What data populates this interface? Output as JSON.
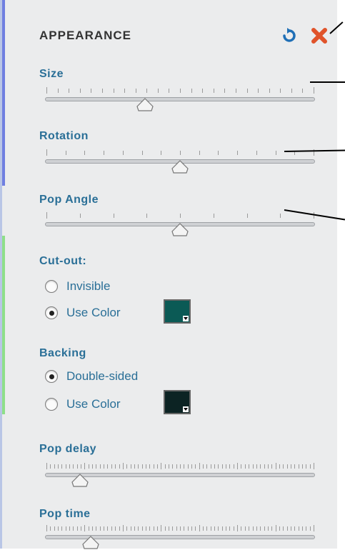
{
  "panel": {
    "title": "APPEARANCE",
    "reset_icon": "reset-icon",
    "close_icon": "close-icon",
    "accent_color": "#2a6f97"
  },
  "sliders": {
    "size": {
      "label": "Size",
      "value": 0.37
    },
    "rotation": {
      "label": "Rotation",
      "value": 0.5
    },
    "pop_angle": {
      "label": "Pop Angle",
      "value": 0.5
    },
    "pop_delay": {
      "label": "Pop delay",
      "value": 0.13
    },
    "pop_time": {
      "label": "Pop time",
      "value": 0.17
    }
  },
  "cutout": {
    "label": "Cut-out:",
    "options": [
      {
        "label": "Invisible",
        "selected": false
      },
      {
        "label": "Use Color",
        "selected": true
      }
    ],
    "color": "#0b5a55"
  },
  "backing": {
    "label": "Backing",
    "options": [
      {
        "label": "Double-sided",
        "selected": true
      },
      {
        "label": "Use Color",
        "selected": false
      }
    ],
    "color": "#0c2323"
  }
}
